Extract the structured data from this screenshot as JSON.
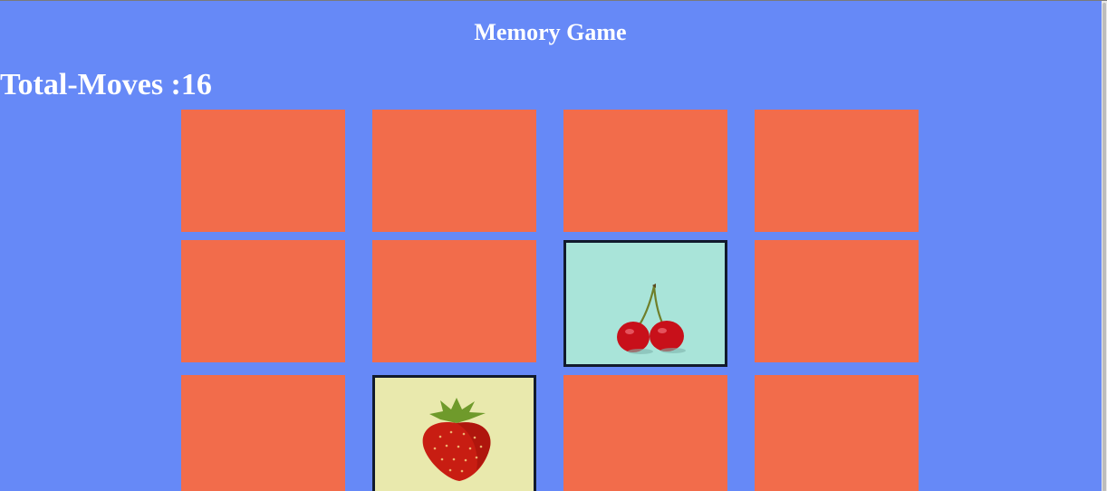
{
  "app": {
    "title": "Memory Game"
  },
  "stats": {
    "moves_text": "Total-Moves :16"
  },
  "cards": [
    {
      "state": "hidden"
    },
    {
      "state": "hidden"
    },
    {
      "state": "hidden"
    },
    {
      "state": "hidden"
    },
    {
      "state": "hidden"
    },
    {
      "state": "hidden"
    },
    {
      "state": "flipped",
      "fruit": "cherry-icon"
    },
    {
      "state": "hidden"
    },
    {
      "state": "hidden"
    },
    {
      "state": "flipped",
      "fruit": "strawberry-icon"
    },
    {
      "state": "hidden"
    },
    {
      "state": "hidden"
    }
  ],
  "colors": {
    "background": "#6689f7",
    "card_back": "#f26c4b",
    "cherry_bg": "#a9e4d9",
    "strawberry_bg": "#e9e9ad"
  }
}
